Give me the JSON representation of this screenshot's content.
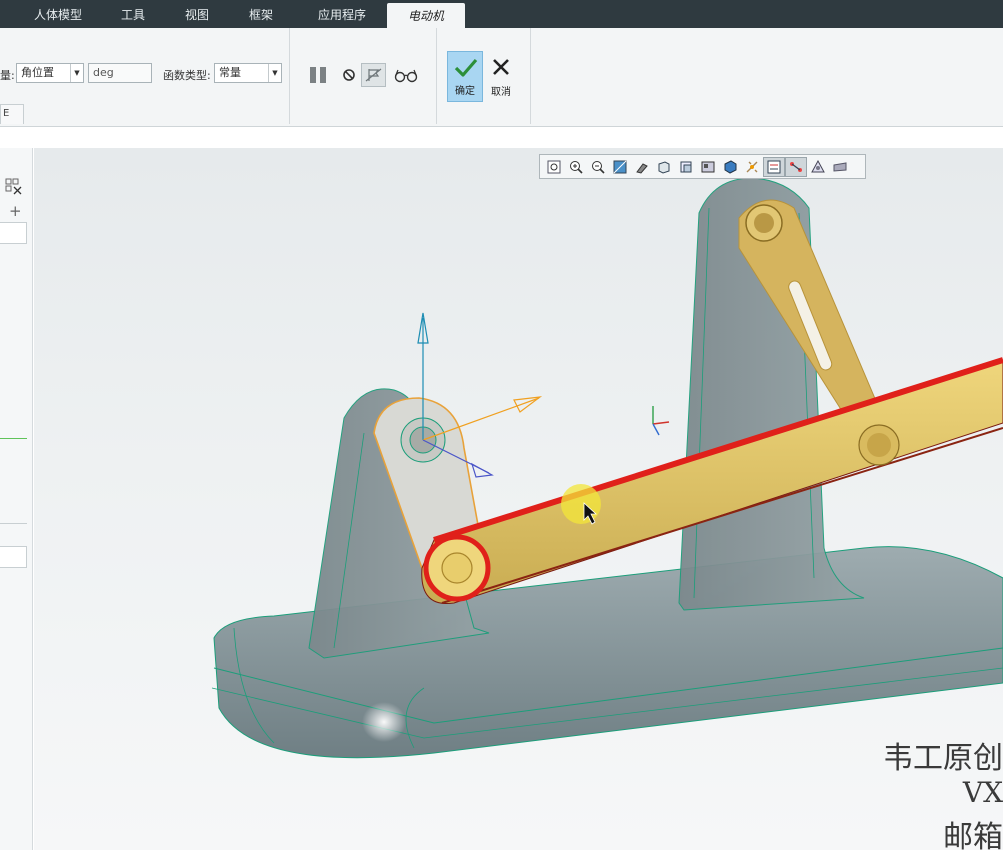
{
  "tabs": [
    {
      "label": "人体模型",
      "active": false
    },
    {
      "label": "工具",
      "active": false
    },
    {
      "label": "视图",
      "active": false
    },
    {
      "label": "框架",
      "active": false
    },
    {
      "label": "应用程序",
      "active": false
    },
    {
      "label": "电动机",
      "active": true
    }
  ],
  "ribbon": {
    "quantity_label_fragment": "量:",
    "quantity_value": "角位置",
    "unit_value": "deg",
    "function_type_label": "函数类型:",
    "function_type_value": "常量",
    "confirm_label": "确定",
    "cancel_label": "取消",
    "lower_tab_fragment": "E"
  },
  "icons": {
    "pause": "pause-icon",
    "stop": "no-entry-icon",
    "flag": "disabled-flag-icon",
    "glasses": "glasses-icon",
    "confirm": "checkmark-icon",
    "cancel": "x-icon"
  },
  "view_toolbar": [
    "zoom-fit-icon",
    "zoom-in-icon",
    "zoom-out-icon",
    "repaint-icon",
    "view-manager-icon",
    "display-style-icon",
    "saved-orientations-icon",
    "named-views-icon",
    "datum-display-icon",
    "spin-center-icon",
    "annotation-display-icon",
    "joint-axes-icon",
    "simulation-display-icon",
    "section-icon"
  ],
  "watermark": {
    "line1": "韦工原创",
    "line2": "VX",
    "line3": "邮箱"
  },
  "colors": {
    "tabbar": "#2f3a40",
    "confirm_button": "#a9d6f2",
    "link_yellow": "#e8c96a",
    "highlight_red": "#e0201a",
    "base_gray": "#8b9b9f"
  }
}
